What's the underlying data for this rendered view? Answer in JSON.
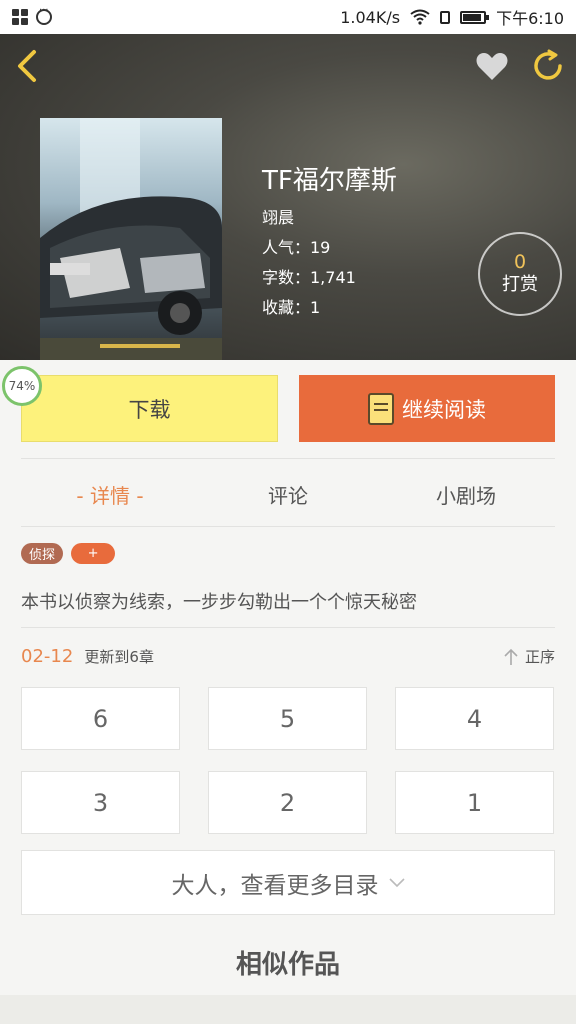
{
  "status_bar": {
    "speed": "1.04K/s",
    "time": "下午6:10"
  },
  "book": {
    "title": "TF福尔摩斯",
    "author": "翊晨",
    "popularity": "人气：19",
    "word_count": "字数：1,741",
    "favorites": "收藏：1"
  },
  "reward": {
    "count": "0",
    "label": "打赏"
  },
  "progress": {
    "label": "74%",
    "value": 0.74
  },
  "actions": {
    "download": "下载",
    "continue_reading": "继续阅读"
  },
  "tabs": [
    {
      "label": "- 详情 -"
    },
    {
      "label": "评论"
    },
    {
      "label": "小剧场"
    }
  ],
  "tags": {
    "genre": "侦探",
    "add": "+"
  },
  "description": "本书以侦察为线索，一步步勾勒出一个个惊天秘密",
  "update": {
    "date": "02-12",
    "text": "更新到6章",
    "sort_label": "正序"
  },
  "chapters": [
    "6",
    "5",
    "4",
    "3",
    "2",
    "1"
  ],
  "more_catalog": "大人，查看更多目录",
  "similar_title": "相似作品",
  "colors": {
    "accent": "#e86b3c",
    "download_bg": "#fdf27c",
    "reward_count": "#f0c25a"
  }
}
